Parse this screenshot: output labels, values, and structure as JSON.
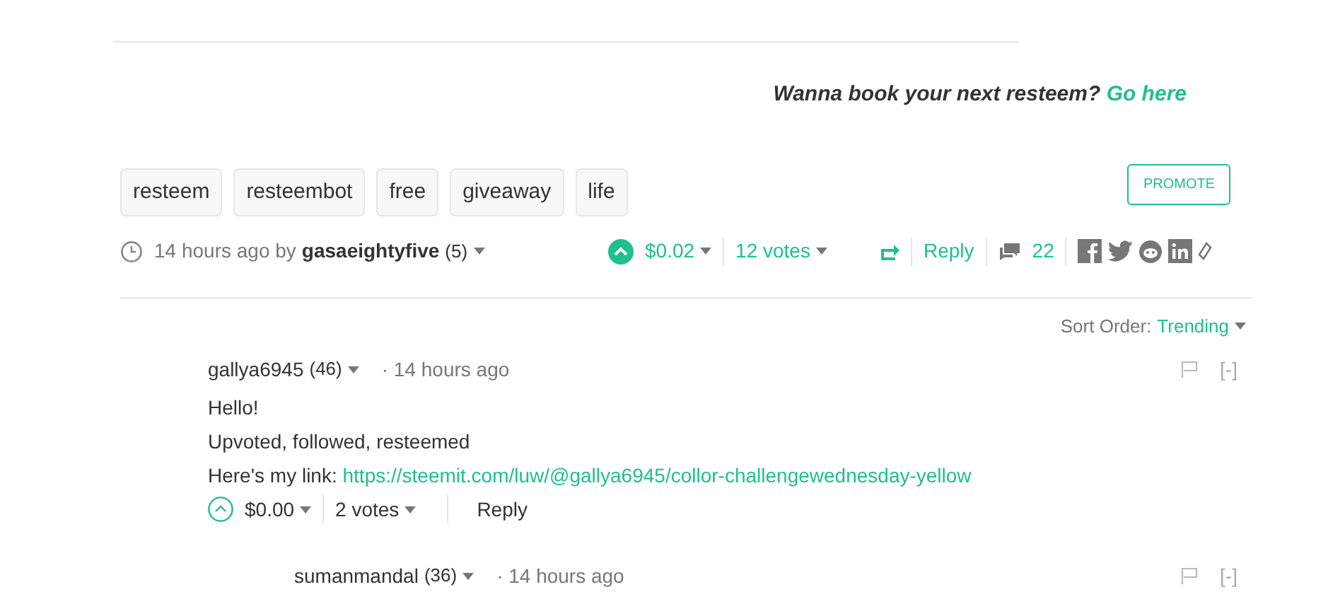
{
  "promo": {
    "text": "Wanna book your next resteem?",
    "link": "Go here"
  },
  "tags": [
    "resteem",
    "resteembot",
    "free",
    "giveaway",
    "life"
  ],
  "promote_button": "PROMOTE",
  "post_meta": {
    "time": "14 hours ago by",
    "author": "gasaeightyfive",
    "reputation": "(5)",
    "voted": true,
    "payout": "$0.02",
    "votes": "12 votes",
    "reply": "Reply",
    "comments": "22"
  },
  "sort": {
    "label": "Sort Order:",
    "value": "Trending"
  },
  "comments": [
    {
      "author": "gallya6945",
      "reputation": "(46)",
      "time": "· 14 hours ago",
      "collapse": "[-]",
      "lines": [
        "Hello!",
        "Upvoted, followed, resteemed"
      ],
      "link_prefix": "Here's my link:",
      "link": "https://steemit.com/luw/@gallya6945/collor-challengewednesday-yellow",
      "voted": false,
      "payout": "$0.00",
      "votes": "2 votes",
      "reply": "Reply",
      "children": [
        {
          "author": "sumanmandal",
          "reputation": "(36)",
          "time": "· 14 hours ago",
          "collapse": "[-]"
        }
      ]
    }
  ]
}
